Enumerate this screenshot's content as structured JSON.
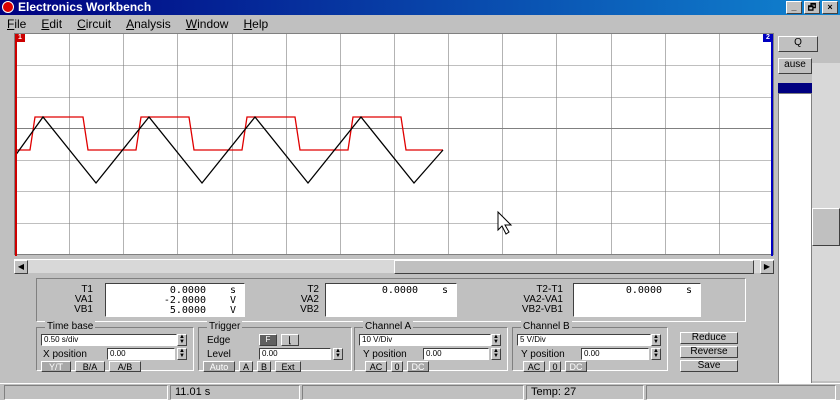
{
  "window": {
    "title": "Electronics Workbench",
    "minimize": "_",
    "maximize": "🗗",
    "close": "×"
  },
  "menu": [
    {
      "pre": "",
      "ul": "F",
      "post": "ile"
    },
    {
      "pre": "",
      "ul": "E",
      "post": "dit"
    },
    {
      "pre": "",
      "ul": "C",
      "post": "ircuit"
    },
    {
      "pre": "",
      "ul": "A",
      "post": "nalysis"
    },
    {
      "pre": "",
      "ul": "W",
      "post": "indow"
    },
    {
      "pre": "",
      "ul": "H",
      "post": "elp"
    }
  ],
  "scope": {
    "cursor1_label": "1",
    "cursor2_label": "2",
    "colors": {
      "channel_a": "#e00000",
      "channel_b": "#000000",
      "grid": "#808080"
    }
  },
  "readout": {
    "group1": {
      "labels": [
        "T1",
        "VA1",
        "VB1"
      ],
      "values": [
        "0.0000",
        "-2.0000",
        "5.0000"
      ],
      "units": [
        "s",
        "V",
        "V"
      ]
    },
    "group2": {
      "labels": [
        "T2",
        "VA2",
        "VB2"
      ],
      "values": [
        "0.0000",
        "",
        ""
      ],
      "units": [
        "s",
        "",
        ""
      ]
    },
    "group3": {
      "labels": [
        "T2-T1",
        "VA2-VA1",
        "VB2-VB1"
      ],
      "values": [
        "0.0000",
        "",
        ""
      ],
      "units": [
        "s",
        "",
        ""
      ]
    }
  },
  "timebase": {
    "legend": "Time base",
    "scale": "0.50 s/div",
    "xpos_label": "X position",
    "xpos_value": "0.00",
    "btn_yt": "Y/T",
    "btn_ba": "B/A",
    "btn_ab": "A/B"
  },
  "trigger": {
    "legend": "Trigger",
    "edge_label": "Edge",
    "edge_rise": "F",
    "edge_fall": "⌊",
    "level_label": "Level",
    "level_value": "0.00",
    "btn_auto": "Auto",
    "btn_a": "A",
    "btn_b": "B",
    "btn_ext": "Ext"
  },
  "channel_a": {
    "legend": "Channel A",
    "scale": "10 V/Div",
    "ypos_label": "Y position",
    "ypos_value": "0.00",
    "btn_ac": "AC",
    "btn_0": "0",
    "btn_dc": "DC"
  },
  "channel_b": {
    "legend": "Channel B",
    "scale": "5 V/Div",
    "ypos_label": "Y position",
    "ypos_value": "0.00",
    "btn_ac": "AC",
    "btn_0": "0",
    "btn_dc": "DC"
  },
  "actions": {
    "reduce": "Reduce",
    "reverse": "Reverse",
    "save": "Save"
  },
  "right_panel": {
    "zoom": "Q",
    "pause": "ause"
  },
  "status": {
    "time": "11.01 s",
    "temp": "Temp:  27"
  }
}
